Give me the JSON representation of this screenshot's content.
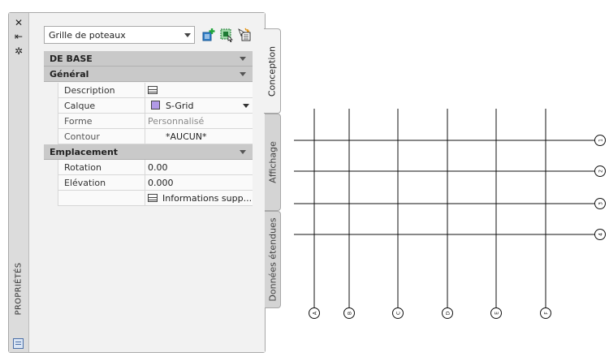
{
  "palette": {
    "title": "PROPRIÉTÉS",
    "strip_icons": [
      "close-icon",
      "auto-hide-icon",
      "settings-icon"
    ],
    "strip_glyphs": [
      "✕",
      "⇤",
      "✲"
    ],
    "type_select": "Grille de poteaux",
    "tool_buttons": [
      "add-selection-icon",
      "quick-select-icon",
      "toggle-pickadd-icon"
    ],
    "tabs": [
      "Conception",
      "Affichage",
      "Données étendues"
    ]
  },
  "sections": {
    "base": "DE BASE",
    "general": "Général",
    "location": "Emplacement"
  },
  "props": {
    "description": {
      "name": "Description",
      "value": ""
    },
    "layer": {
      "name": "Calque",
      "value": "S-Grid",
      "swatch": "#b19ae6"
    },
    "shape": {
      "name": "Forme",
      "value": "Personnalisé"
    },
    "contour": {
      "name": "Contour",
      "value": "*AUCUN*"
    },
    "rotation": {
      "name": "Rotation",
      "value": "0.00"
    },
    "elevation": {
      "name": "Elévation",
      "value": "0.000"
    },
    "extra": {
      "name": "",
      "value": "Informations supp..."
    }
  },
  "grid": {
    "row_labels": [
      "1",
      "2",
      "3",
      "4"
    ],
    "column_labels": [
      "A",
      "B",
      "C",
      "D",
      "E",
      "F"
    ]
  }
}
